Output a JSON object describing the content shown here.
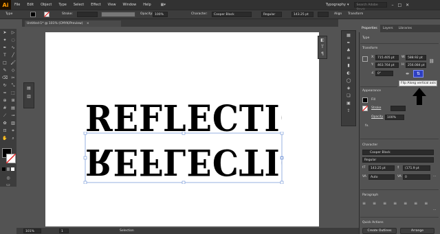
{
  "app": {
    "logo": "Ai"
  },
  "menu": [
    "File",
    "Edit",
    "Object",
    "Type",
    "Select",
    "Effect",
    "View",
    "Window",
    "Help"
  ],
  "workspace": {
    "label": "Typography",
    "search_placeholder": "Search Adobe Stock"
  },
  "control_bar": {
    "type_label": "Type",
    "stroke_label": "Stroke:",
    "opacity_label": "Opacity:",
    "opacity_value": "100%",
    "character_label": "Character:",
    "font_family": "Cooper Black",
    "font_style": "Regular",
    "font_size": "143.25 pt",
    "align_label": "Align",
    "transform_label": "Transform"
  },
  "document": {
    "tab_title": "Untitled-1* @ 101% (CMYK/Preview)",
    "close": "×"
  },
  "artwork": {
    "text": "REFLECTION"
  },
  "status": {
    "zoom": "101%",
    "page": "1",
    "tool": "Selection"
  },
  "panel": {
    "tabs": [
      "Properties",
      "Layers",
      "Libraries"
    ],
    "type_section": "Type",
    "transform_section": "Transform",
    "x_label": "X:",
    "x_value": "715.405 pt",
    "y_label": "Y:",
    "y_value": "463.764 pt",
    "w_label": "W:",
    "w_value": "588.92 pt",
    "h_label": "H:",
    "h_value": "256.084 pt",
    "rotate_value": "0°",
    "tooltip": "Flip Along vertical axis",
    "appearance_section": "Appearance",
    "fill_label": "Fill",
    "stroke_label": "Stroke",
    "opacity_label": "Opacity",
    "opacity_value": "100%",
    "fx_label": "fx.",
    "character_section": "Character",
    "font_family": "Cooper Black",
    "font_style": "Regular",
    "font_size": "143.25 pt",
    "leading": "(171.9 pt",
    "kerning": "Auto",
    "tracking": "0",
    "paragraph_section": "Paragraph",
    "quick_actions_section": "Quick Actions",
    "create_outlines": "Create Outlines",
    "arrange": "Arrange"
  },
  "colors": {
    "tooltip_highlight": "#2e3fbf",
    "logo": "#ff9a00",
    "selection": "#6b8fd6"
  }
}
